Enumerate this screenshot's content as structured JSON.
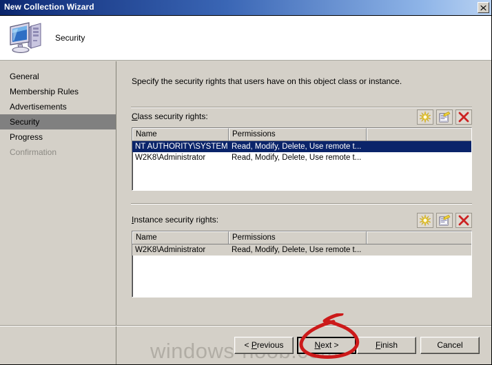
{
  "window": {
    "title": "New Collection Wizard",
    "close_label": "Close",
    "close_icon": "close-icon"
  },
  "header": {
    "title": "Security",
    "icon": "computer-icon"
  },
  "sidebar": {
    "items": [
      {
        "label": "General",
        "state": "normal"
      },
      {
        "label": "Membership Rules",
        "state": "normal"
      },
      {
        "label": "Advertisements",
        "state": "normal"
      },
      {
        "label": "Security",
        "state": "selected"
      },
      {
        "label": "Progress",
        "state": "normal"
      },
      {
        "label": "Confirmation",
        "state": "disabled"
      }
    ]
  },
  "main": {
    "instruction": "Specify the security rights that users have on this object class or instance.",
    "class_section": {
      "label": "Class security rights:",
      "toolbar": [
        {
          "name": "new-icon",
          "tooltip": "New"
        },
        {
          "name": "properties-icon",
          "tooltip": "Properties"
        },
        {
          "name": "delete-icon",
          "tooltip": "Delete"
        }
      ],
      "columns": [
        "Name",
        "Permissions"
      ],
      "rows": [
        {
          "name": "NT AUTHORITY\\SYSTEM",
          "permissions": "Read, Modify, Delete, Use remote t...",
          "selected": "active"
        },
        {
          "name": "W2K8\\Administrator",
          "permissions": "Read, Modify, Delete, Use remote t...",
          "selected": "none"
        }
      ]
    },
    "instance_section": {
      "label": "Instance security rights:",
      "toolbar": [
        {
          "name": "new-icon",
          "tooltip": "New"
        },
        {
          "name": "properties-icon",
          "tooltip": "Properties"
        },
        {
          "name": "delete-icon",
          "tooltip": "Delete"
        }
      ],
      "columns": [
        "Name",
        "Permissions"
      ],
      "rows": [
        {
          "name": "W2K8\\Administrator",
          "permissions": "Read, Modify, Delete, Use remote t...",
          "selected": "inactive"
        }
      ]
    }
  },
  "footer": {
    "previous": "< Previous",
    "next": "Next >",
    "finish": "Finish",
    "cancel": "Cancel"
  },
  "watermark": {
    "text": "windows-noob.com"
  },
  "annotation": {
    "type": "hand-drawn-circle",
    "target": "next-button",
    "color": "#cc1a1a"
  },
  "colors": {
    "titlebar_start": "#0a246a",
    "titlebar_end": "#b9d2f2",
    "dialog_face": "#d4d0c8",
    "selection_active": "#0a246a",
    "selection_inactive": "#d4d0c8",
    "sidebar_selected": "#808080",
    "annotation_red": "#cc1a1a"
  }
}
